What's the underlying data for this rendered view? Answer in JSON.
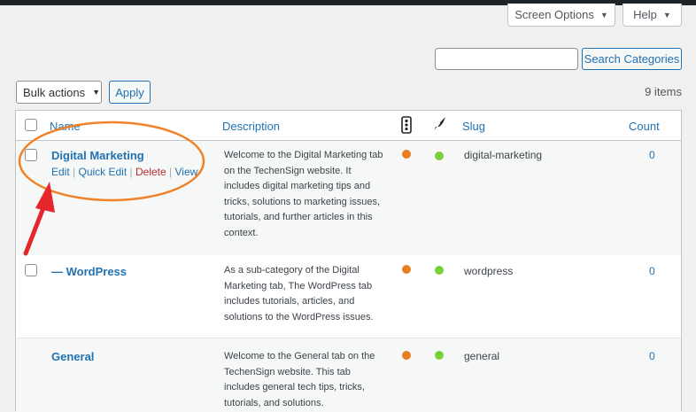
{
  "header": {
    "screen_options_label": "Screen Options",
    "help_label": "Help"
  },
  "search": {
    "value": "",
    "button_label": "Search Categories"
  },
  "bulk": {
    "selected": "Bulk actions",
    "apply_label": "Apply"
  },
  "items_count": "9 items",
  "columns": {
    "name": "Name",
    "description": "Description",
    "readability_icon": "traffic-light-icon",
    "seo_icon": "feather-icon",
    "slug": "Slug",
    "count": "Count"
  },
  "row_actions": {
    "edit": "Edit",
    "quick_edit": "Quick Edit",
    "delete": "Delete",
    "view": "View",
    "separator": "|"
  },
  "rows": [
    {
      "name": "Digital Marketing",
      "description": "Welcome to the Digital Marketing tab on the TechenSign website. It includes digital marketing tips and tricks, solutions to marketing issues, tutorials, and further articles in this context.",
      "slug": "digital-marketing",
      "count": "0"
    },
    {
      "name": "— WordPress",
      "description": "As a sub-category of the Digital Marketing tab,  The WordPress tab includes tutorials, articles, and solutions to the WordPress issues.",
      "slug": "wordpress",
      "count": "0"
    },
    {
      "name": "General",
      "description": "Welcome to the General tab on the TechenSign website. This tab includes general tech tips, tricks, tutorials, and solutions.",
      "slug": "general",
      "count": "0"
    }
  ],
  "colors": {
    "accent": "#2271b1",
    "delete": "#b32d2e",
    "dot_orange": "#e67e22",
    "dot_green": "#7ad03a",
    "annotation_orange": "#f0832a",
    "annotation_red": "#e5262a"
  }
}
